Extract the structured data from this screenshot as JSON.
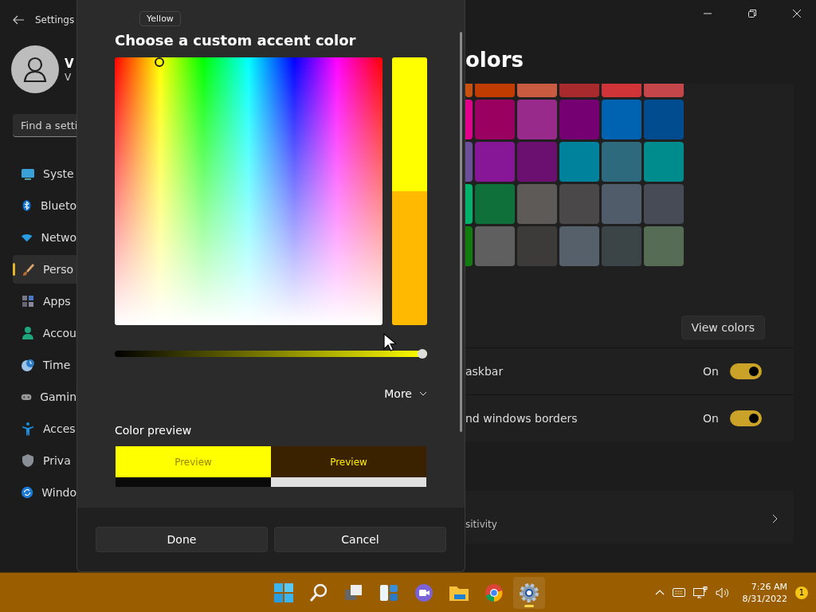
{
  "window": {
    "title": "Settings"
  },
  "sidebar": {
    "user_name": "V",
    "user_detail": "V",
    "search": {
      "placeholder": "Find a setti"
    },
    "items": [
      {
        "label": "Syste",
        "selected": false
      },
      {
        "label": "Blueto",
        "selected": false
      },
      {
        "label": "Netwo",
        "selected": false
      },
      {
        "label": "Perso",
        "selected": true
      },
      {
        "label": "Apps",
        "selected": false
      },
      {
        "label": "Accou",
        "selected": false
      },
      {
        "label": "Time",
        "selected": false
      },
      {
        "label": "Gamin",
        "selected": false
      },
      {
        "label": "Acces",
        "selected": false
      },
      {
        "label": "Priva",
        "selected": false
      },
      {
        "label": "Windo",
        "selected": false
      }
    ]
  },
  "tooltip": "Yellow",
  "dialog": {
    "title": "Choose a custom accent color",
    "color_bar": [
      {
        "color": "#ffff00"
      },
      {
        "color": "#ffb900"
      }
    ],
    "brightness": {
      "level": 1
    },
    "more": "More",
    "preview": {
      "label": "Color preview",
      "tiles": [
        {
          "text": "Preview",
          "kind": "light",
          "color": "#ffff00"
        },
        {
          "text": "Preview",
          "kind": "dark",
          "color": "#3a2200"
        }
      ]
    },
    "buttons": [
      "Done",
      "Cancel"
    ]
  },
  "content": {
    "heading": "olors",
    "swatch_rows": [
      [
        {
          "color": "#ca5010"
        },
        {
          "color": "#c13c00"
        },
        {
          "color": "#c95b41"
        },
        {
          "color": "#a82a2c"
        },
        {
          "color": "#d13438"
        },
        {
          "color": "#c4454a"
        }
      ],
      [
        {
          "color": "#e3008c"
        },
        {
          "color": "#9a0060"
        },
        {
          "color": "#982a8c"
        },
        {
          "color": "#740072"
        },
        {
          "color": "#0063b1"
        },
        {
          "color": "#004c8f"
        }
      ],
      [
        {
          "color": "#6b4f9a"
        },
        {
          "color": "#881798"
        },
        {
          "color": "#6b0f70"
        },
        {
          "color": "#00819c"
        },
        {
          "color": "#2d6a7e"
        },
        {
          "color": "#008b8d"
        }
      ],
      [
        {
          "color": "#00b26a"
        },
        {
          "color": "#10703a"
        },
        {
          "color": "#5d5a58"
        },
        {
          "color": "#4a4848"
        },
        {
          "color": "#515c6b"
        },
        {
          "color": "#464b55"
        }
      ],
      [
        {
          "color": "#107c10"
        },
        {
          "color": "#5f5f5f"
        },
        {
          "color": "#3c3b39"
        },
        {
          "color": "#56606a"
        },
        {
          "color": "#3b4446"
        },
        {
          "color": "#566c54"
        }
      ]
    ],
    "view_colors": "View colors",
    "toggles": [
      {
        "label": "askbar",
        "state": "On",
        "on": true
      },
      {
        "label": "nd windows borders",
        "state": "On",
        "on": true
      }
    ],
    "link_row": {
      "label": "sitivity"
    }
  },
  "taskbar": {
    "apps": [
      {
        "kind": "start",
        "selected": false
      },
      {
        "kind": "search",
        "selected": false
      },
      {
        "kind": "taskview",
        "selected": false
      },
      {
        "kind": "widgets",
        "selected": false
      },
      {
        "kind": "chat",
        "selected": false
      },
      {
        "kind": "files",
        "selected": false
      },
      {
        "kind": "browser",
        "selected": false
      },
      {
        "kind": "settings",
        "selected": true
      }
    ],
    "time": "7:26 AM",
    "date": "8/31/2022",
    "badge": "1"
  }
}
